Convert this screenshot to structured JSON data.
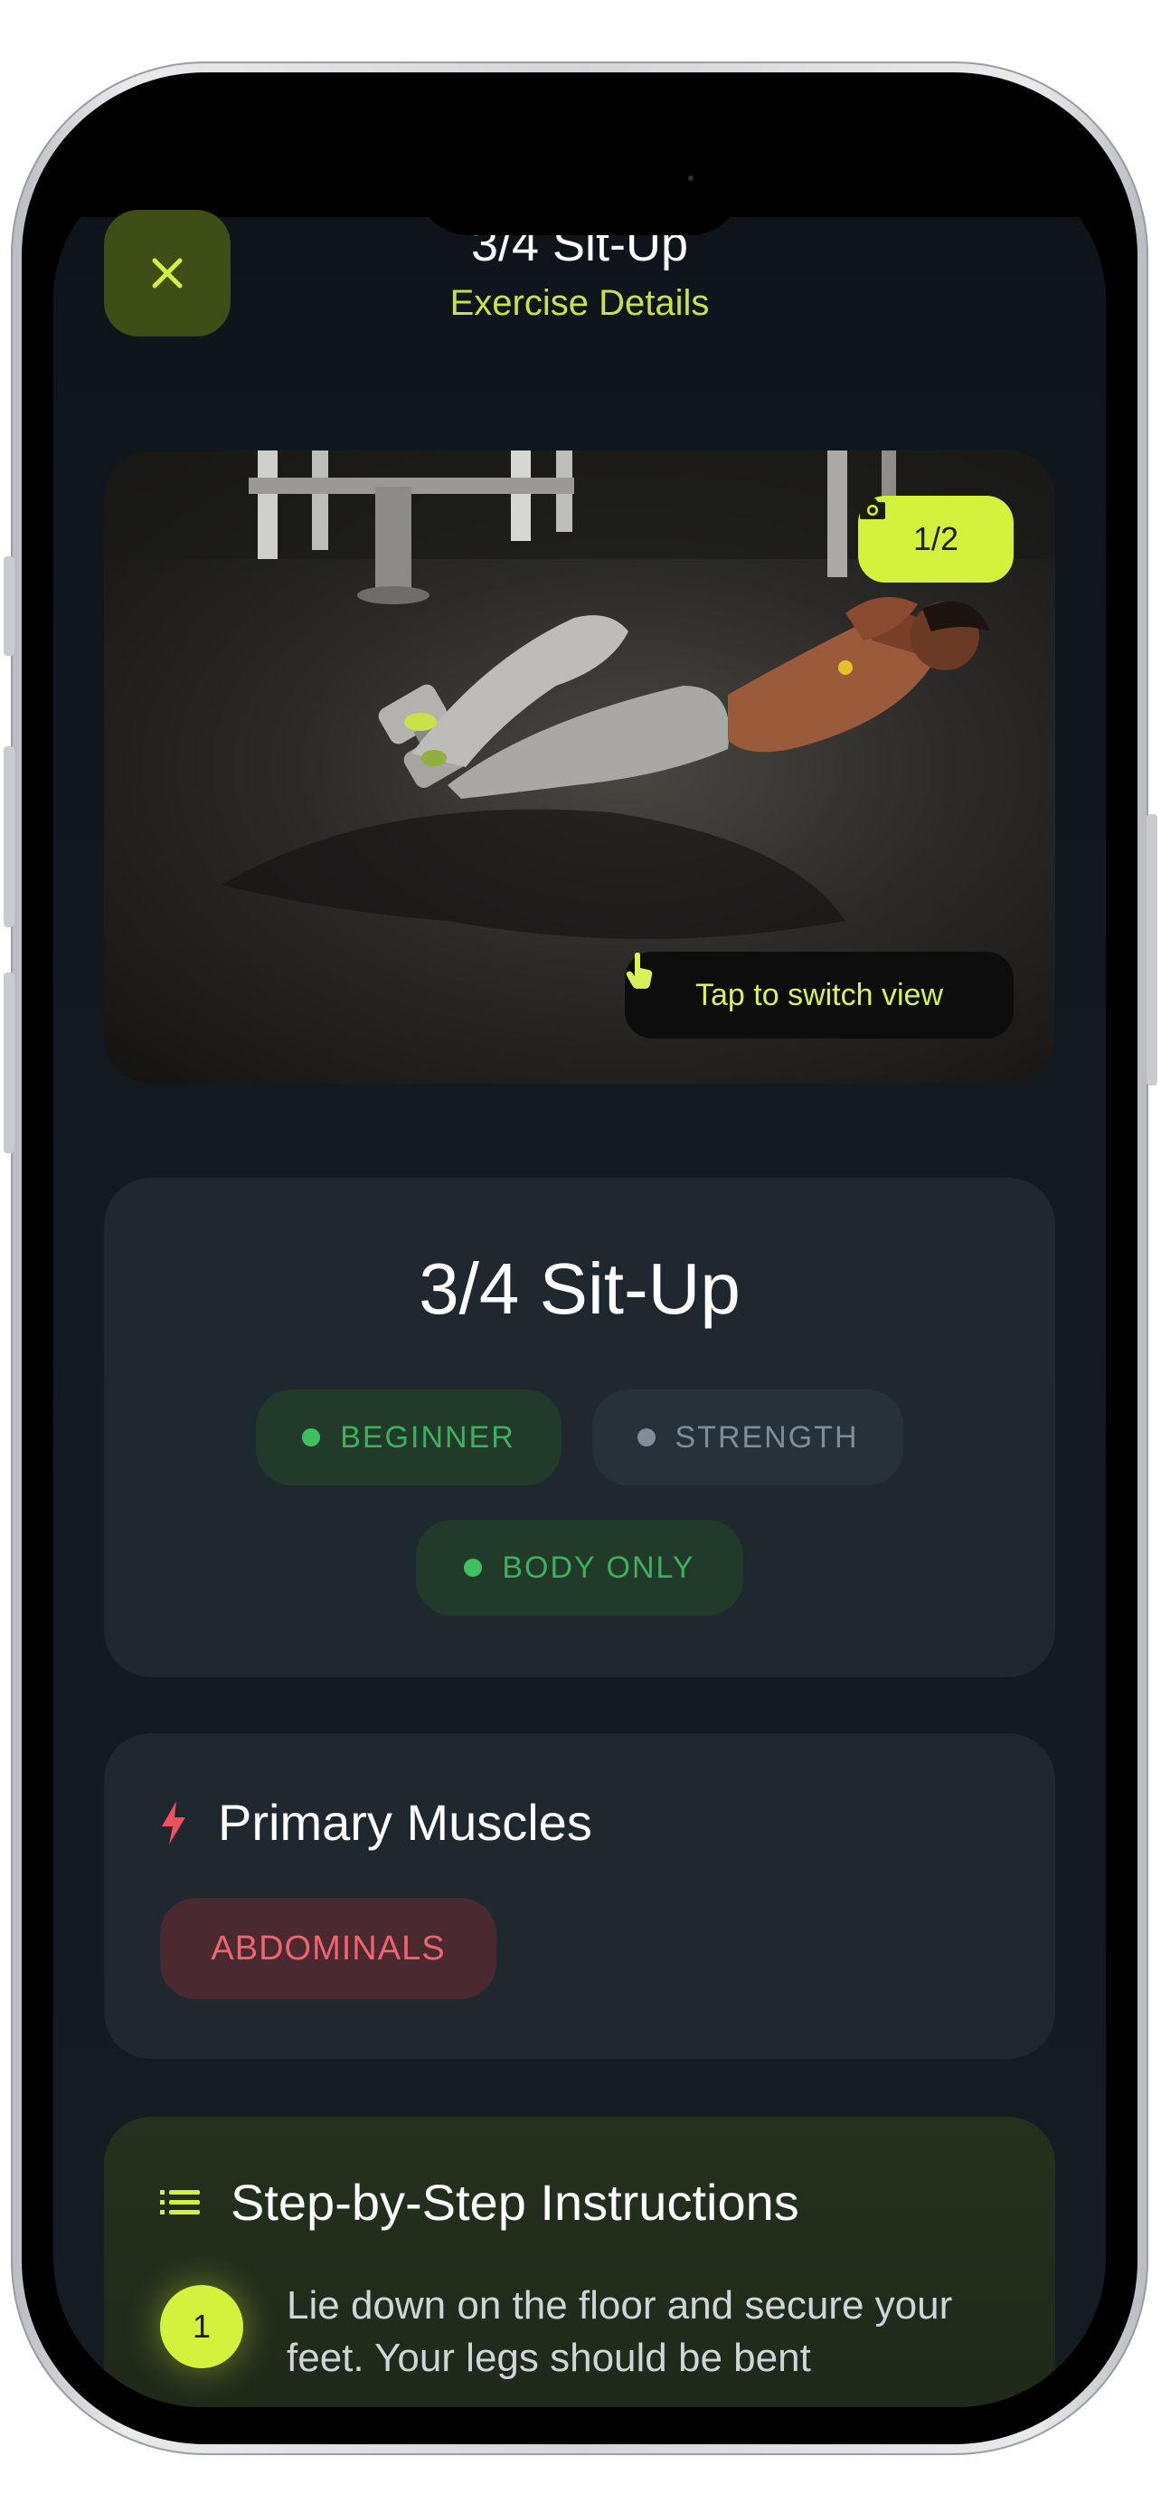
{
  "header": {
    "title": "3/4 Sit-Up",
    "subtitle": "Exercise Details",
    "close_icon": "close-icon"
  },
  "media": {
    "counter": "1/2",
    "camera_icon": "camera-icon",
    "switch_label": "Tap to switch view",
    "tap_icon": "tap-hand-icon"
  },
  "exercise": {
    "name": "3/4 Sit-Up",
    "tags": [
      {
        "label": "BEGINNER",
        "color": "#3fbf5f"
      },
      {
        "label": "STRENGTH",
        "color": "#7e8d98"
      },
      {
        "label": "BODY ONLY",
        "color": "#3fbf5f"
      }
    ]
  },
  "primary_muscles": {
    "heading": "Primary Muscles",
    "icon": "lightning-icon",
    "items": [
      "ABDOMINALS"
    ]
  },
  "instructions": {
    "heading": "Step-by-Step Instructions",
    "icon": "list-icon",
    "steps": [
      {
        "number": "1",
        "text": "Lie down on the floor and secure your feet. Your legs should be bent"
      }
    ]
  },
  "colors": {
    "accent": "#d4f23c",
    "background": "#0e141a",
    "card": "#1f272f",
    "danger": "#f06470"
  }
}
